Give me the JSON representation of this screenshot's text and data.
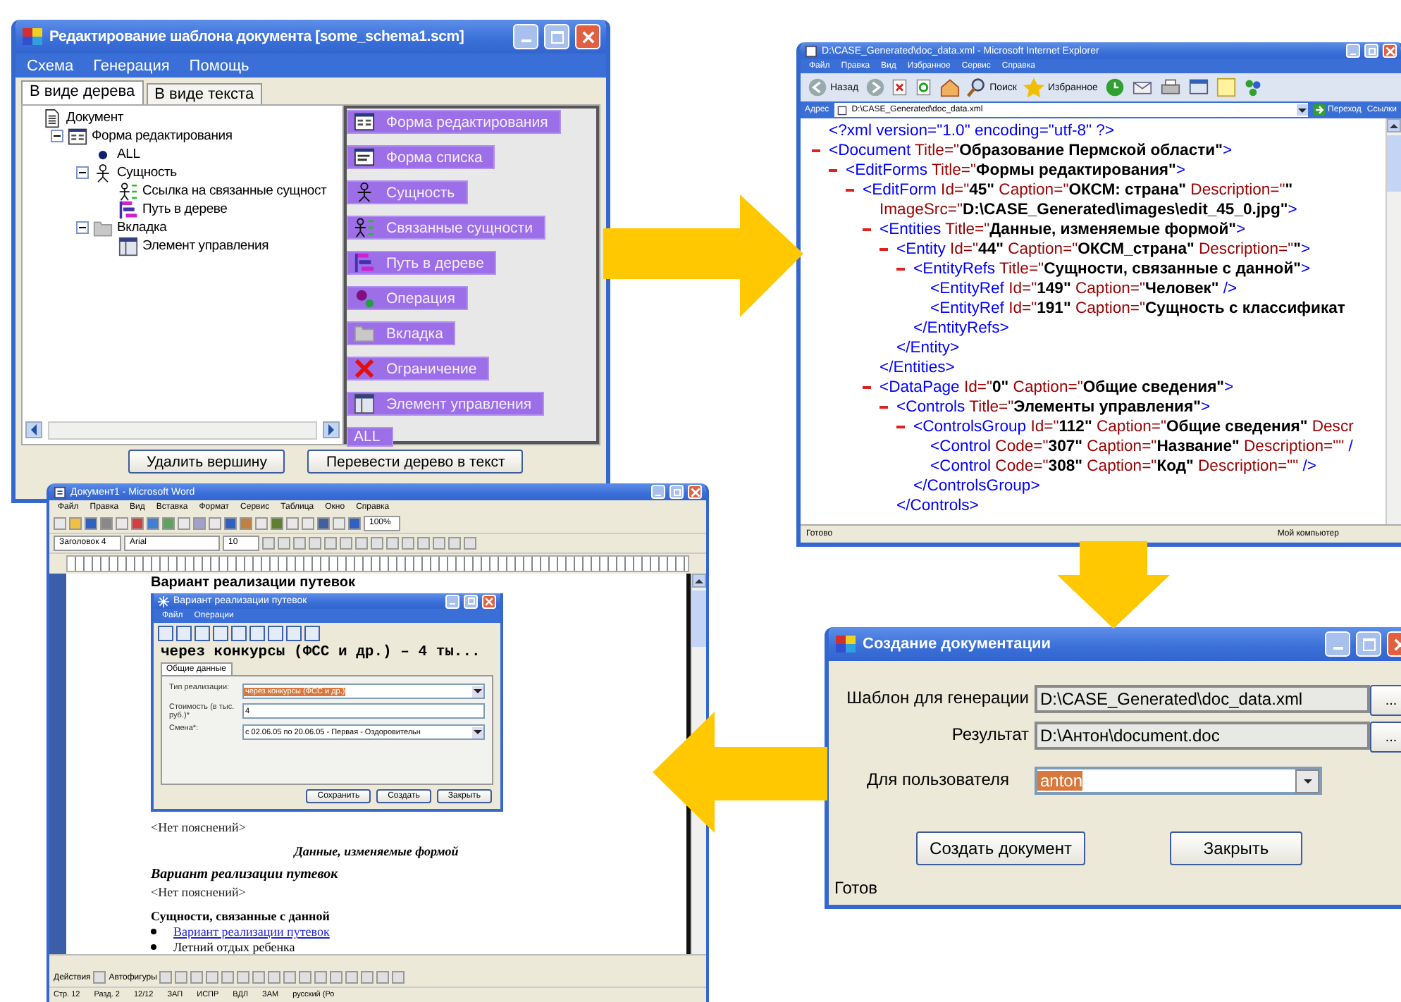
{
  "editor_window": {
    "title": "Редактирование шаблона документа [some_schema1.scm]",
    "menu": [
      "Схема",
      "Генерация",
      "Помощь"
    ],
    "tabs": [
      {
        "label": "В виде дерева",
        "selected": true
      },
      {
        "label": "В виде текста",
        "selected": false
      }
    ],
    "tree": [
      {
        "label": "Документ",
        "kind": "document",
        "children": [
          {
            "label": "Форма редактирования",
            "kind": "form",
            "expanded": true,
            "children": [
              {
                "label": "ALL",
                "kind": "bullet"
              },
              {
                "label": "Сущность",
                "kind": "entity",
                "expanded": true,
                "children": [
                  {
                    "label": "Ссылка на связанные сущност",
                    "kind": "linked"
                  },
                  {
                    "label": "Путь в дереве",
                    "kind": "path"
                  }
                ]
              },
              {
                "label": "Вкладка",
                "kind": "tab",
                "expanded": true,
                "children": [
                  {
                    "label": "Элемент управления",
                    "kind": "control"
                  }
                ]
              }
            ]
          }
        ]
      }
    ],
    "palette": [
      {
        "label": "Форма редактирования",
        "kind": "form"
      },
      {
        "label": "Форма списка",
        "kind": "list"
      },
      {
        "label": "Сущность",
        "kind": "entity"
      },
      {
        "label": "Связанные сущности",
        "kind": "linked"
      },
      {
        "label": "Путь в дереве",
        "kind": "path"
      },
      {
        "label": "Операция",
        "kind": "operation"
      },
      {
        "label": "Вкладка",
        "kind": "tab"
      },
      {
        "label": "Ограничение",
        "kind": "restriction"
      },
      {
        "label": "Элемент управления",
        "kind": "control"
      },
      {
        "label": "ALL",
        "kind": "all"
      }
    ],
    "buttons": [
      "Удалить вершину",
      "Перевести дерево в текст"
    ]
  },
  "browser_window": {
    "title": "D:\\CASE_Generated\\doc_data.xml - Microsoft Internet Explorer",
    "menu": [
      "Файл",
      "Правка",
      "Вид",
      "Избранное",
      "Сервис",
      "Справка"
    ],
    "toolbar": {
      "back": "Назад",
      "search": "Поиск",
      "favorites": "Избранное"
    },
    "address": {
      "label": "Адрес",
      "value": "D:\\CASE_Generated\\doc_data.xml",
      "go": "Переход",
      "links": "Ссылки"
    },
    "xml": [
      {
        "fold": false,
        "lines": [
          [
            {
              "kind": "tag",
              "text": "<?xml version=\"1.0\" encoding=\"utf-8\" ?>"
            }
          ]
        ]
      },
      {
        "fold": true,
        "lines": [
          [
            {
              "kind": "tag",
              "text": "<Document"
            },
            {
              "kind": "attr",
              "text": " Title=\""
            },
            {
              "kind": "value",
              "text": "Образование Пермской области\""
            },
            {
              "kind": "tag",
              "text": ">"
            }
          ]
        ],
        "children": [
          {
            "fold": true,
            "lines": [
              [
                {
                  "kind": "tag",
                  "text": "<EditForms"
                },
                {
                  "kind": "attr",
                  "text": " Title=\""
                },
                {
                  "kind": "value",
                  "text": "Формы редактирования\""
                },
                {
                  "kind": "tag",
                  "text": ">"
                }
              ]
            ],
            "children": [
              {
                "fold": true,
                "lines": [
                  [
                    {
                      "kind": "tag",
                      "text": "<EditForm"
                    },
                    {
                      "kind": "attr",
                      "text": " Id=\""
                    },
                    {
                      "kind": "value",
                      "text": "45\""
                    },
                    {
                      "kind": "attr",
                      "text": " Caption=\""
                    },
                    {
                      "kind": "value",
                      "text": "ОКСМ: страна\""
                    },
                    {
                      "kind": "attr",
                      "text": " Description=\""
                    },
                    {
                      "kind": "value",
                      "text": "\""
                    }
                  ],
                  [
                    {
                      "kind": "attr",
                      "text": "ImageSrc=\""
                    },
                    {
                      "kind": "value",
                      "text": "D:\\CASE_Generated\\images\\edit_45_0.jpg\""
                    },
                    {
                      "kind": "tag",
                      "text": ">"
                    }
                  ]
                ],
                "children": [
                  {
                    "fold": true,
                    "lines": [
                      [
                        {
                          "kind": "tag",
                          "text": "<Entities"
                        },
                        {
                          "kind": "attr",
                          "text": " Title=\""
                        },
                        {
                          "kind": "value",
                          "text": "Данные, изменяемые формой\""
                        },
                        {
                          "kind": "tag",
                          "text": ">"
                        }
                      ]
                    ],
                    "children": [
                      {
                        "fold": true,
                        "lines": [
                          [
                            {
                              "kind": "tag",
                              "text": "<Entity"
                            },
                            {
                              "kind": "attr",
                              "text": " Id=\""
                            },
                            {
                              "kind": "value",
                              "text": "44\""
                            },
                            {
                              "kind": "attr",
                              "text": " Caption=\""
                            },
                            {
                              "kind": "value",
                              "text": "ОКСМ_страна\""
                            },
                            {
                              "kind": "attr",
                              "text": " Description=\""
                            },
                            {
                              "kind": "value",
                              "text": "\""
                            },
                            {
                              "kind": "tag",
                              "text": ">"
                            }
                          ]
                        ],
                        "children": [
                          {
                            "fold": true,
                            "lines": [
                              [
                                {
                                  "kind": "tag",
                                  "text": "<EntityRefs"
                                },
                                {
                                  "kind": "attr",
                                  "text": " Title=\""
                                },
                                {
                                  "kind": "value",
                                  "text": "Сущности, связанные с данной\""
                                },
                                {
                                  "kind": "tag",
                                  "text": ">"
                                }
                              ]
                            ],
                            "children": [
                              {
                                "fold": false,
                                "lines": [
                                  [
                                    {
                                      "kind": "tag",
                                      "text": "<EntityRef"
                                    },
                                    {
                                      "kind": "attr",
                                      "text": " Id=\""
                                    },
                                    {
                                      "kind": "value",
                                      "text": "149\""
                                    },
                                    {
                                      "kind": "attr",
                                      "text": " Caption=\""
                                    },
                                    {
                                      "kind": "value",
                                      "text": "Человек\""
                                    },
                                    {
                                      "kind": "tag",
                                      "text": " />"
                                    }
                                  ]
                                ]
                              },
                              {
                                "fold": false,
                                "lines": [
                                  [
                                    {
                                      "kind": "tag",
                                      "text": "<EntityRef"
                                    },
                                    {
                                      "kind": "attr",
                                      "text": " Id=\""
                                    },
                                    {
                                      "kind": "value",
                                      "text": "191\""
                                    },
                                    {
                                      "kind": "attr",
                                      "text": " Caption=\""
                                    },
                                    {
                                      "kind": "value",
                                      "text": "Сущность с классификат"
                                    }
                                  ]
                                ]
                              }
                            ],
                            "close": [
                              {
                                "kind": "tag",
                                "text": "</EntityRefs>"
                              }
                            ]
                          }
                        ],
                        "close": [
                          {
                            "kind": "tag",
                            "text": "</Entity>"
                          }
                        ]
                      }
                    ],
                    "close": [
                      {
                        "kind": "tag",
                        "text": "</Entities>"
                      }
                    ]
                  },
                  {
                    "fold": true,
                    "lines": [
                      [
                        {
                          "kind": "tag",
                          "text": "<DataPage"
                        },
                        {
                          "kind": "attr",
                          "text": " Id=\""
                        },
                        {
                          "kind": "value",
                          "text": "0\""
                        },
                        {
                          "kind": "attr",
                          "text": " Caption=\""
                        },
                        {
                          "kind": "value",
                          "text": "Общие сведения\""
                        },
                        {
                          "kind": "tag",
                          "text": ">"
                        }
                      ]
                    ],
                    "children": [
                      {
                        "fold": true,
                        "lines": [
                          [
                            {
                              "kind": "tag",
                              "text": "<Controls"
                            },
                            {
                              "kind": "attr",
                              "text": " Title=\""
                            },
                            {
                              "kind": "value",
                              "text": "Элементы управления\""
                            },
                            {
                              "kind": "tag",
                              "text": ">"
                            }
                          ]
                        ],
                        "children": [
                          {
                            "fold": true,
                            "lines": [
                              [
                                {
                                  "kind": "tag",
                                  "text": "<ControlsGroup"
                                },
                                {
                                  "kind": "attr",
                                  "text": " Id=\""
                                },
                                {
                                  "kind": "value",
                                  "text": "112\""
                                },
                                {
                                  "kind": "attr",
                                  "text": " Caption=\""
                                },
                                {
                                  "kind": "value",
                                  "text": "Общие сведения\""
                                },
                                {
                                  "kind": "attr",
                                  "text": " Descr"
                                }
                              ]
                            ],
                            "children": [
                              {
                                "fold": false,
                                "lines": [
                                  [
                                    {
                                      "kind": "tag",
                                      "text": "<Control"
                                    },
                                    {
                                      "kind": "attr",
                                      "text": " Code=\""
                                    },
                                    {
                                      "kind": "value",
                                      "text": "307\""
                                    },
                                    {
                                      "kind": "attr",
                                      "text": " Caption=\""
                                    },
                                    {
                                      "kind": "value",
                                      "text": "Название\""
                                    },
                                    {
                                      "kind": "attr",
                                      "text": " Description=\"\""
                                    },
                                    {
                                      "kind": "tag",
                                      "text": " /"
                                    }
                                  ]
                                ]
                              },
                              {
                                "fold": false,
                                "lines": [
                                  [
                                    {
                                      "kind": "tag",
                                      "text": "<Control"
                                    },
                                    {
                                      "kind": "attr",
                                      "text": " Code=\""
                                    },
                                    {
                                      "kind": "value",
                                      "text": "308\""
                                    },
                                    {
                                      "kind": "attr",
                                      "text": " Caption=\""
                                    },
                                    {
                                      "kind": "value",
                                      "text": "Код\""
                                    },
                                    {
                                      "kind": "attr",
                                      "text": " Description=\"\""
                                    },
                                    {
                                      "kind": "tag",
                                      "text": " />"
                                    }
                                  ]
                                ]
                              }
                            ],
                            "close": [
                              {
                                "kind": "tag",
                                "text": "</ControlsGroup>"
                              }
                            ]
                          }
                        ],
                        "close": [
                          {
                            "kind": "tag",
                            "text": "</Controls>"
                          }
                        ]
                      }
                    ]
                  }
                ]
              }
            ]
          }
        ]
      }
    ],
    "status": {
      "text": "Готово",
      "zone": "Мой компьютер"
    }
  },
  "word_window": {
    "title": "Документ1 - Microsoft Word",
    "menu": [
      "Файл",
      "Правка",
      "Вид",
      "Вставка",
      "Формат",
      "Сервис",
      "Таблица",
      "Окно",
      "Справка"
    ],
    "zoom": "100%",
    "style": "Заголовок 4",
    "font": "Arial",
    "size": "10",
    "document": [
      {
        "kind": "heading",
        "text": "Вариант реализации путевок"
      },
      {
        "kind": "form",
        "title": "Вариант реализации путевок",
        "menu": [
          "Файл",
          "Операции"
        ],
        "header": "через конкурсы (ФСС и др.) – 4 ты...",
        "tab": "Общие данные",
        "fields": [
          {
            "kind": "combo",
            "label": "Тип реализации:",
            "value": "через конкурсы (ФСС и др.)",
            "highlighted": true
          },
          {
            "kind": "text",
            "label": "Стоимость (в тыс. руб.)*",
            "value": "4",
            "highlighted": false
          },
          {
            "kind": "combo",
            "label": "Смена*:",
            "value": "с 02.06.05 по 20.06.05 - Первая - Оздоровительн",
            "highlighted": false
          }
        ],
        "buttons": [
          "Сохранить",
          "Создать",
          "Закрыть"
        ]
      },
      {
        "kind": "note",
        "text": "<Нет пояснений>"
      },
      {
        "kind": "caption",
        "text": "Данные, изменяемые формой"
      },
      {
        "kind": "subheading",
        "text": "Вариант реализации путевок"
      },
      {
        "kind": "note",
        "text": "<Нет пояснений>"
      },
      {
        "kind": "section",
        "text": "Сущности, связанные с данной"
      },
      {
        "kind": "link_item",
        "text": "Вариант реализации путевок"
      },
      {
        "kind": "item",
        "text": "Летний отдых ребенка"
      }
    ],
    "drawing_bar": [
      "Действия",
      "Автофигуры"
    ],
    "status": [
      "Стр. 12",
      "Разд. 2",
      "12/12",
      "ЗАП",
      "ИСПР",
      "ВДЛ",
      "ЗАМ",
      "русский (Ро"
    ]
  },
  "create_window": {
    "title": "Создание документации",
    "fields": [
      {
        "kind": "path",
        "label": "Шаблон для генерации",
        "value": "D:\\CASE_Generated\\doc_data.xml",
        "button": "...",
        "highlighted": false
      },
      {
        "kind": "path",
        "label": "Результат",
        "value": "D:\\Антон\\document.doc",
        "button": "...",
        "highlighted": false
      },
      {
        "kind": "combo",
        "label": "Для пользователя",
        "value": "anton",
        "highlighted": true
      }
    ],
    "buttons": [
      "Создать документ",
      "Закрыть"
    ],
    "status": "Готов"
  }
}
